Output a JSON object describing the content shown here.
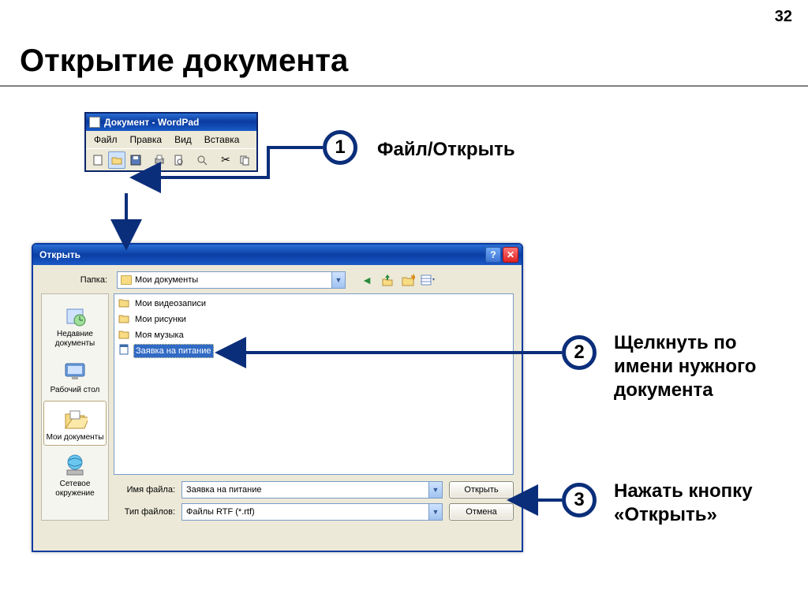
{
  "page_number": "32",
  "page_title": "Открытие документа",
  "wordpad": {
    "title": "Документ - WordPad",
    "menu": [
      "Файл",
      "Правка",
      "Вид",
      "Вставка"
    ]
  },
  "open_dialog": {
    "title": "Открыть",
    "lookin_label": "Папка:",
    "lookin_value": "Мои документы",
    "places": [
      {
        "label": "Недавние документы"
      },
      {
        "label": "Рабочий стол"
      },
      {
        "label": "Мои документы"
      },
      {
        "label": "Сетевое окружение"
      }
    ],
    "files": [
      {
        "name": "Мои видеозаписи",
        "type": "folder"
      },
      {
        "name": "Мои рисунки",
        "type": "folder"
      },
      {
        "name": "Моя музыка",
        "type": "folder"
      },
      {
        "name": "Заявка на питание",
        "type": "doc",
        "selected": true
      }
    ],
    "filename_label": "Имя файла:",
    "filename_value": "Заявка на питание",
    "filetype_label": "Тип файлов:",
    "filetype_value": "Файлы RTF (*.rtf)",
    "open_btn": "Открыть",
    "cancel_btn": "Отмена"
  },
  "steps": {
    "s1": {
      "num": "1",
      "text": "Файл/Открыть"
    },
    "s2": {
      "num": "2",
      "text": "Щелкнуть по имени нужного документа"
    },
    "s3": {
      "num": "3",
      "text": "Нажать кнопку «Открыть»"
    }
  }
}
